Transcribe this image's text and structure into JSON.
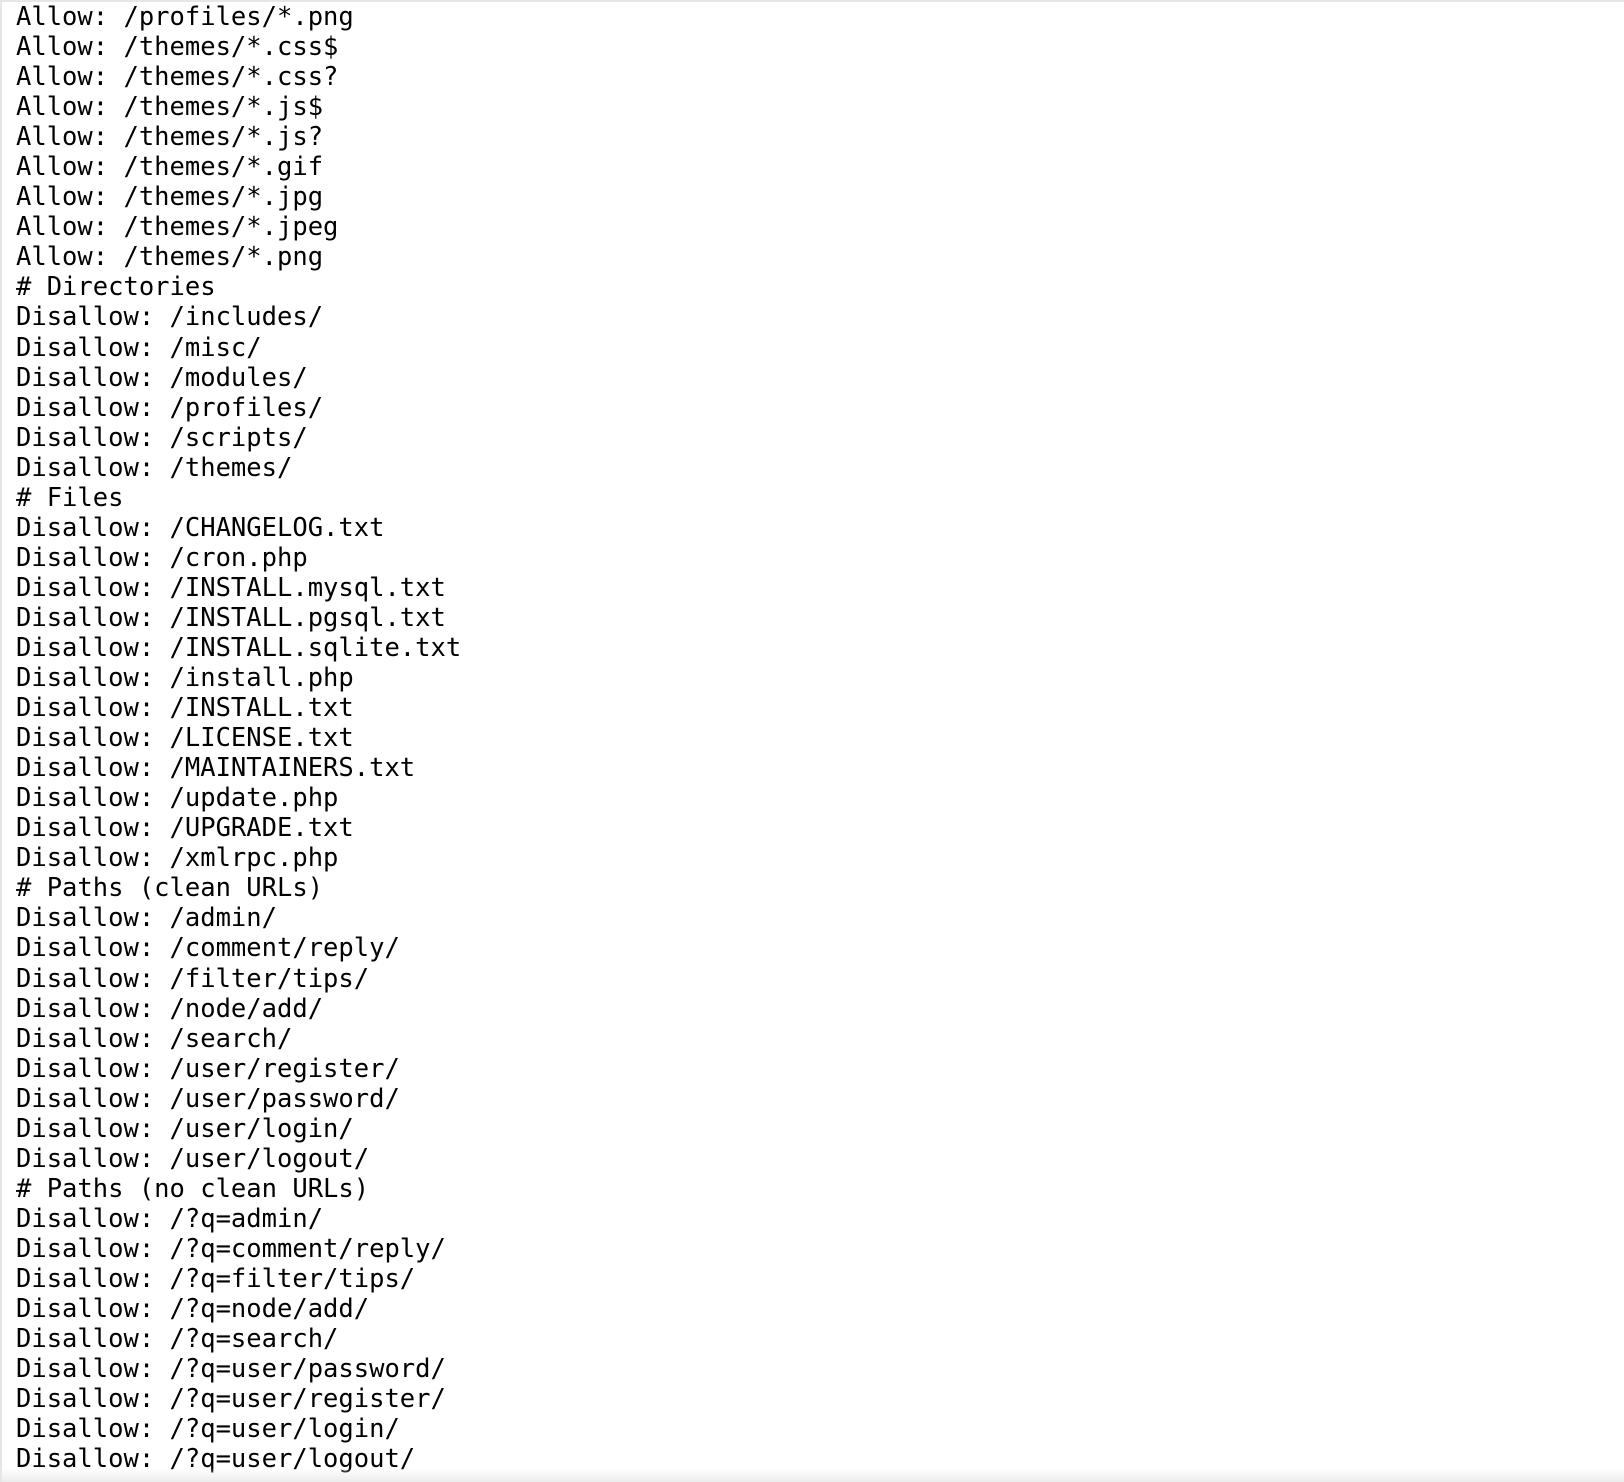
{
  "document": {
    "lines": [
      "Allow: /profiles/*.png",
      "Allow: /themes/*.css$",
      "Allow: /themes/*.css?",
      "Allow: /themes/*.js$",
      "Allow: /themes/*.js?",
      "Allow: /themes/*.gif",
      "Allow: /themes/*.jpg",
      "Allow: /themes/*.jpeg",
      "Allow: /themes/*.png",
      "# Directories",
      "Disallow: /includes/",
      "Disallow: /misc/",
      "Disallow: /modules/",
      "Disallow: /profiles/",
      "Disallow: /scripts/",
      "Disallow: /themes/",
      "# Files",
      "Disallow: /CHANGELOG.txt",
      "Disallow: /cron.php",
      "Disallow: /INSTALL.mysql.txt",
      "Disallow: /INSTALL.pgsql.txt",
      "Disallow: /INSTALL.sqlite.txt",
      "Disallow: /install.php",
      "Disallow: /INSTALL.txt",
      "Disallow: /LICENSE.txt",
      "Disallow: /MAINTAINERS.txt",
      "Disallow: /update.php",
      "Disallow: /UPGRADE.txt",
      "Disallow: /xmlrpc.php",
      "# Paths (clean URLs)",
      "Disallow: /admin/",
      "Disallow: /comment/reply/",
      "Disallow: /filter/tips/",
      "Disallow: /node/add/",
      "Disallow: /search/",
      "Disallow: /user/register/",
      "Disallow: /user/password/",
      "Disallow: /user/login/",
      "Disallow: /user/logout/",
      "# Paths (no clean URLs)",
      "Disallow: /?q=admin/",
      "Disallow: /?q=comment/reply/",
      "Disallow: /?q=filter/tips/",
      "Disallow: /?q=node/add/",
      "Disallow: /?q=search/",
      "Disallow: /?q=user/password/",
      "Disallow: /?q=user/register/",
      "Disallow: /?q=user/login/",
      "Disallow: /?q=user/logout/"
    ]
  }
}
